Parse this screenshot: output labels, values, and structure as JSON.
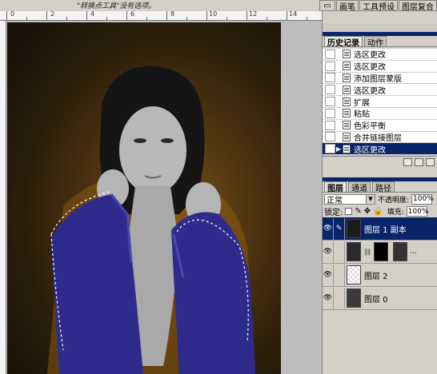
{
  "options_bar": {
    "hint_text": "\"转换点工具\"没有选项。"
  },
  "palette_well": {
    "tabs": [
      "画笔",
      "工具预设",
      "图层复合"
    ]
  },
  "ruler": {
    "labels": [
      "0",
      "2",
      "4",
      "6",
      "8",
      "10",
      "12",
      "14"
    ]
  },
  "history_panel": {
    "tabs": [
      "历史记录",
      "动作"
    ],
    "items": [
      {
        "label": "选区更改"
      },
      {
        "label": "选区更改"
      },
      {
        "label": "添加图层蒙版"
      },
      {
        "label": "选区更改"
      },
      {
        "label": "扩展"
      },
      {
        "label": "粘贴"
      },
      {
        "label": "色彩平衡"
      },
      {
        "label": "合并链接图层"
      },
      {
        "label": "选区更改",
        "selected": true
      }
    ]
  },
  "layers_panel": {
    "tabs": [
      "图层",
      "通道",
      "路径"
    ],
    "blend_mode": "正常",
    "opacity_label": "不透明度:",
    "opacity_value": "100%",
    "lock_label": "锁定:",
    "fill_label": "填充:",
    "fill_value": "100%",
    "layers": [
      {
        "name": "图层 1 副本",
        "selected": true
      },
      {
        "name": "",
        "has_mask": true,
        "more": "..."
      },
      {
        "name": "图层 2"
      },
      {
        "name": "图层 0"
      }
    ]
  },
  "colors": {
    "selection_blue": "#0a246a",
    "panel_gray": "#d4d0c8",
    "coat_purple": "#2c2a8a",
    "background_brown": "#6b4614"
  }
}
